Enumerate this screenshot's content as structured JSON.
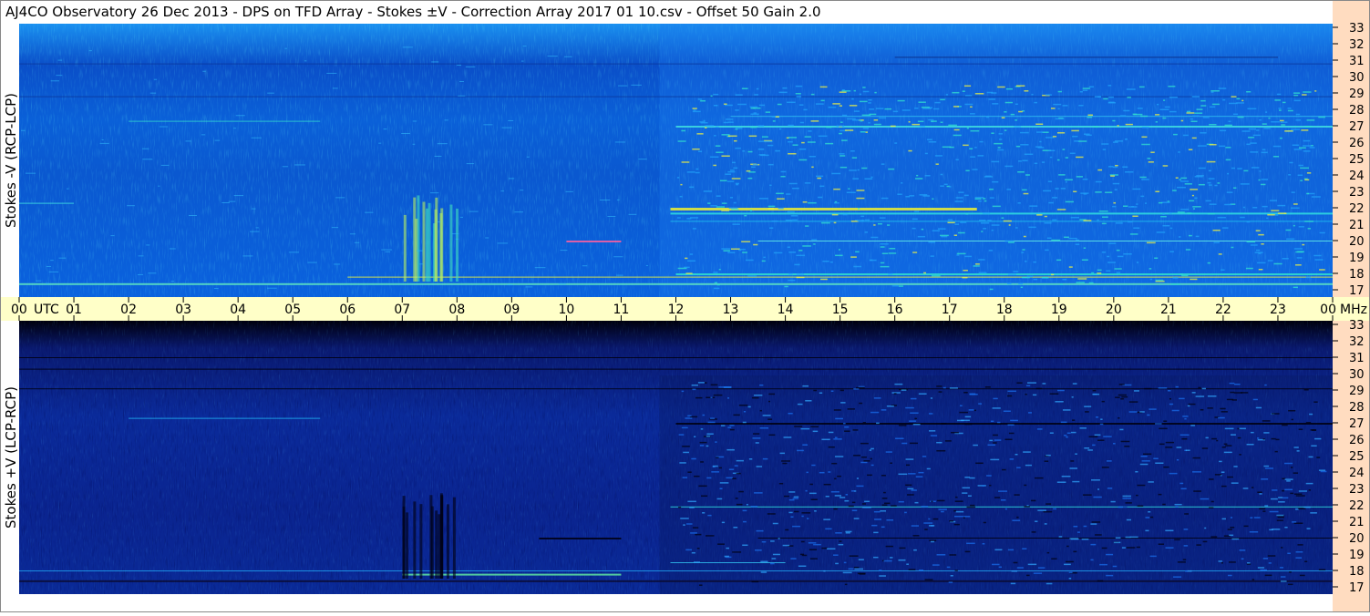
{
  "title": "AJ4CO Observatory  26 Dec 2013  -  DPS on TFD Array  -  Stokes ±V  -  Correction Array 2017 01 10.csv  -  Offset 50  Gain 2.0",
  "chart_data": [
    {
      "type": "heatmap",
      "ylabel": "Stokes -V (RCP-LCP)",
      "y_axis_values": [
        "33",
        "32",
        "31",
        "30",
        "29",
        "28",
        "27",
        "26",
        "25",
        "24",
        "23",
        "22",
        "21",
        "20",
        "19",
        "18",
        "17"
      ],
      "y_unit": "MHz",
      "x_axis_values": [
        "00",
        "01",
        "02",
        "03",
        "04",
        "05",
        "06",
        "07",
        "08",
        "09",
        "10",
        "11",
        "12",
        "13",
        "14",
        "15",
        "16",
        "17",
        "18",
        "19",
        "20",
        "21",
        "22",
        "23",
        "00"
      ],
      "x_axis_label": "UTC",
      "xlim": [
        0,
        24
      ],
      "ylim": [
        17,
        33.5
      ],
      "colors": {
        "base": "#0a66e0",
        "high": "#f8f830",
        "mid": "#20e0d0"
      }
    },
    {
      "type": "heatmap",
      "ylabel": "Stokes +V (LCP-RCP)",
      "y_axis_values": [
        "33",
        "32",
        "31",
        "30",
        "29",
        "28",
        "27",
        "26",
        "25",
        "24",
        "23",
        "22",
        "21",
        "20",
        "19",
        "18",
        "17"
      ],
      "y_unit": "MHz",
      "x_axis_values": [
        "00",
        "01",
        "02",
        "03",
        "04",
        "05",
        "06",
        "07",
        "08",
        "09",
        "10",
        "11",
        "12",
        "13",
        "14",
        "15",
        "16",
        "17",
        "18",
        "19",
        "20",
        "21",
        "22",
        "23",
        "00"
      ],
      "x_axis_label": "UTC",
      "xlim": [
        0,
        24
      ],
      "ylim": [
        17,
        33.5
      ],
      "colors": {
        "base": "#0a2a90",
        "low": "#000010",
        "mid": "#1a8cff"
      }
    }
  ],
  "time_axis": {
    "hours": [
      "00",
      "01",
      "02",
      "03",
      "04",
      "05",
      "06",
      "07",
      "08",
      "09",
      "10",
      "11",
      "12",
      "13",
      "14",
      "15",
      "16",
      "17",
      "18",
      "19",
      "20",
      "21",
      "22",
      "23",
      "00"
    ],
    "utc_label": "UTC",
    "unit_label": "MHz",
    "colors": {
      "band": "#ffffc8",
      "text": "#000000"
    }
  },
  "freq_axis": {
    "colors": {
      "band": "#ffdcc0"
    }
  }
}
